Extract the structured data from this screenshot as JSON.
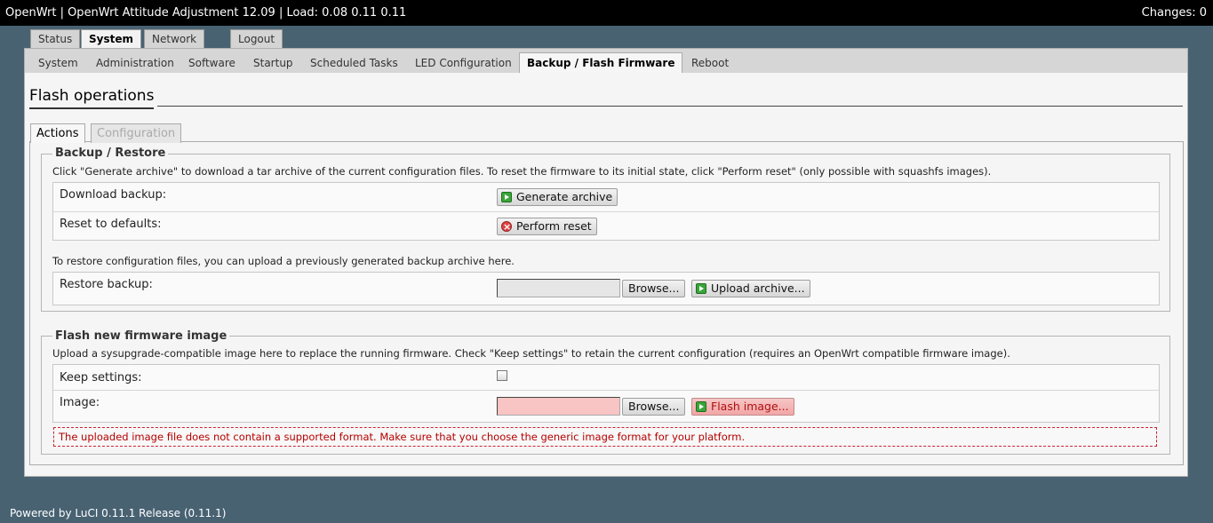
{
  "header": {
    "title": "OpenWrt | OpenWrt Attitude Adjustment 12.09 | Load: 0.08 0.11 0.11",
    "changes": "Changes: 0"
  },
  "main_tabs": {
    "status": "Status",
    "system": "System",
    "network": "Network",
    "logout": "Logout"
  },
  "sub_tabs": {
    "system": "System",
    "administration": "Administration",
    "software": "Software",
    "startup": "Startup",
    "scheduled": "Scheduled Tasks",
    "led": "LED Configuration",
    "backup": "Backup / Flash Firmware",
    "reboot": "Reboot"
  },
  "page": {
    "title": "Flash operations",
    "tabs": {
      "actions": "Actions",
      "configuration": "Configuration"
    }
  },
  "backup": {
    "legend": "Backup / Restore",
    "description": "Click \"Generate archive\" to download a tar archive of the current configuration files. To reset the firmware to its initial state, click \"Perform reset\" (only possible with squashfs images).",
    "download_label": "Download backup:",
    "generate_button": "Generate archive",
    "reset_label": "Reset to defaults:",
    "reset_button": "Perform reset",
    "restore_description": "To restore configuration files, you can upload a previously generated backup archive here.",
    "restore_label": "Restore backup:",
    "browse_button": "Browse...",
    "upload_button": "Upload archive..."
  },
  "flash": {
    "legend": "Flash new firmware image",
    "description": "Upload a sysupgrade-compatible image here to replace the running firmware. Check \"Keep settings\" to retain the current configuration (requires an OpenWrt compatible firmware image).",
    "keep_label": "Keep settings:",
    "keep_checked": false,
    "image_label": "Image:",
    "browse_button": "Browse...",
    "flash_button": "Flash image...",
    "error": "The uploaded image file does not contain a supported format. Make sure that you choose the generic image format for your platform."
  },
  "footer": {
    "text": "Powered by LuCI 0.11.1 Release (0.11.1)"
  },
  "colors": {
    "background": "#486272",
    "header": "#000000",
    "error_text": "#b50000",
    "error_input": "#f8c4c4"
  }
}
